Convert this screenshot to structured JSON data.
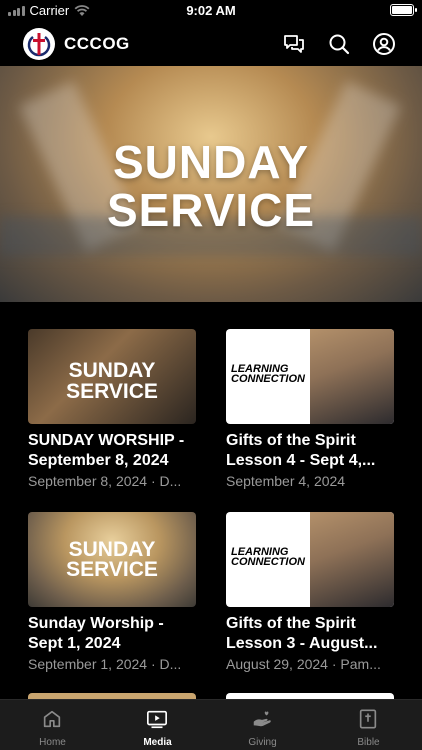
{
  "status_bar": {
    "carrier": "Carrier",
    "time": "9:02 AM"
  },
  "app": {
    "title": "CCCOG"
  },
  "hero": {
    "line1": "SUNDAY",
    "line2": "SERVICE"
  },
  "media": [
    {
      "title1": "SUNDAY WORSHIP -",
      "title2": "September 8, 2024",
      "subtitle": "September 8, 2024 · D...",
      "thumb_line1": "SUNDAY",
      "thumb_line2": "SERVICE"
    },
    {
      "title1": "Gifts of the Spirit",
      "title2": "Lesson  4 - Sept 4,...",
      "subtitle": "September 4, 2024",
      "thumb_line1": "LEARNING",
      "thumb_line2": "CONNECTION"
    },
    {
      "title1": "Sunday Worship -",
      "title2": "Sept 1, 2024",
      "subtitle": "September 1, 2024 · D...",
      "thumb_line1": "SUNDAY",
      "thumb_line2": "SERVICE"
    },
    {
      "title1": "Gifts of the Spirit",
      "title2": "Lesson  3 - August...",
      "subtitle": "August 29, 2024 · Pam...",
      "thumb_line1": "LEARNING",
      "thumb_line2": "CONNECTION"
    }
  ],
  "tabs": [
    {
      "label": "Home",
      "icon": "home-icon"
    },
    {
      "label": "Media",
      "icon": "play-icon"
    },
    {
      "label": "Giving",
      "icon": "giving-icon"
    },
    {
      "label": "Bible",
      "icon": "bible-icon"
    }
  ],
  "active_tab": "Media",
  "colors": {
    "background": "#000000",
    "tab_bar": "#1c1c1c",
    "subtitle": "#9a9a9a",
    "logo_red": "#c8102e"
  }
}
